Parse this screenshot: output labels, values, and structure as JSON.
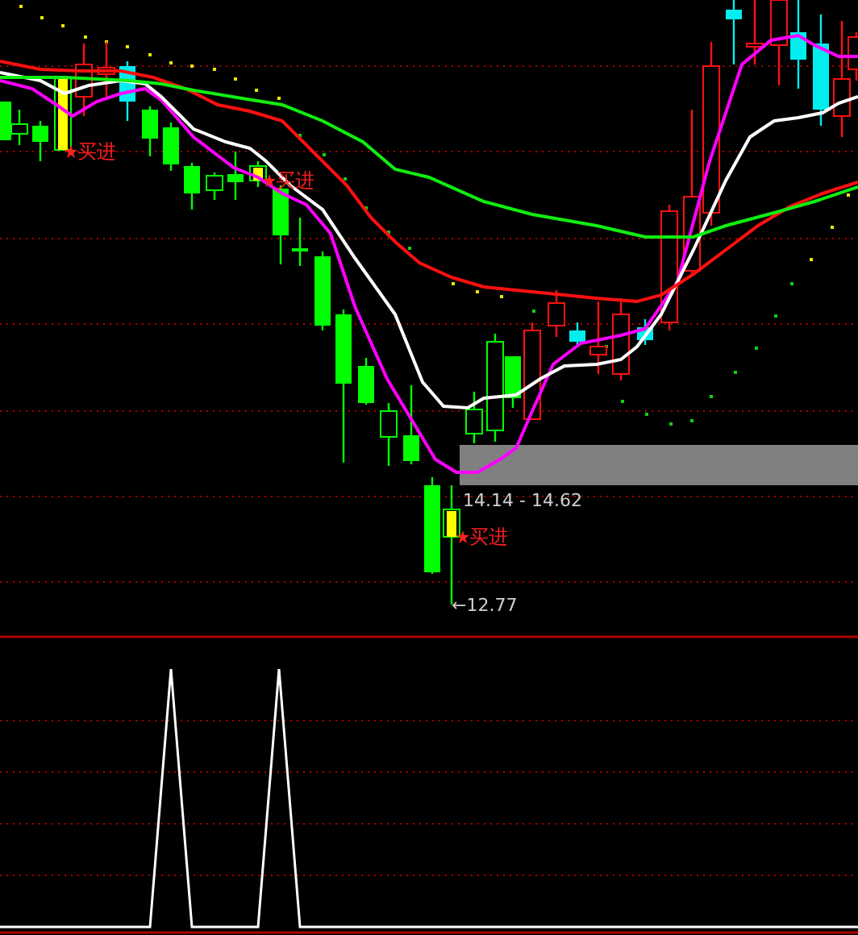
{
  "main_chart": {
    "signals": [
      {
        "label": "买进"
      },
      {
        "label": "买进"
      },
      {
        "label": "买进"
      }
    ],
    "zone": {
      "label": "14.14 - 14.62"
    },
    "low_marker": {
      "label": "←12.77"
    }
  }
}
